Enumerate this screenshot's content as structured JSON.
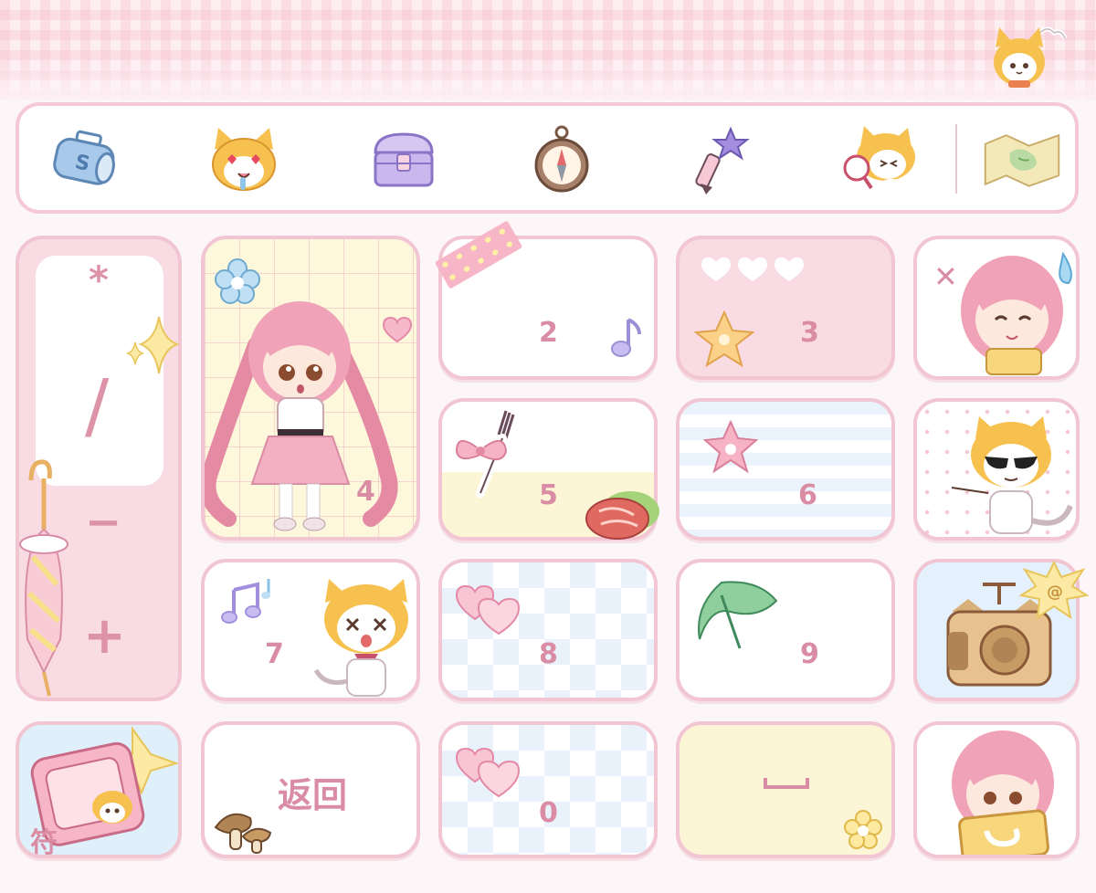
{
  "toolbar": {
    "items": [
      {
        "name": "sticker-bag-icon"
      },
      {
        "name": "heart-eyes-cat-icon"
      },
      {
        "name": "treasure-chest-icon"
      },
      {
        "name": "compass-icon"
      },
      {
        "name": "magic-wand-icon"
      },
      {
        "name": "detective-cat-icon"
      },
      {
        "name": "treasure-map-icon"
      }
    ]
  },
  "operators": {
    "multiply": "*",
    "divide": "/",
    "minus": "−",
    "plus": "+"
  },
  "keys": {
    "k1": "",
    "k2": "2",
    "k3": "3",
    "k4": "4",
    "k5": "5",
    "k6": "6",
    "k7": "7",
    "k8": "8",
    "k9": "9",
    "k0": "0",
    "symbols": "符",
    "back": "返回",
    "space": "⎵"
  },
  "colors": {
    "accent": "#d98ca4",
    "border": "#f2c5d2",
    "pink_fill": "#f9dbe4",
    "cream_fill": "#fdf6d6"
  }
}
